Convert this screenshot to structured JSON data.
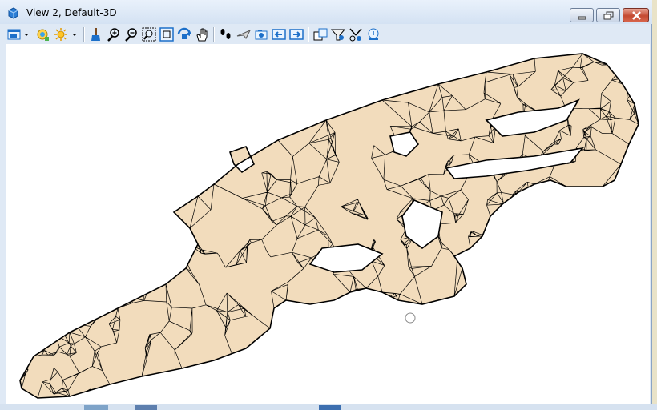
{
  "window": {
    "title": "View 2, Default-3D",
    "controls": {
      "minimize": "minimize",
      "maximize": "restore",
      "close": "close"
    }
  },
  "toolbar": {
    "items": [
      "view-attributes",
      "display-style",
      "lighting",
      "fit-view-brush",
      "zoom-in",
      "zoom-out",
      "window-area",
      "fit-view",
      "rotate-view",
      "pan-view",
      "walk",
      "fly",
      "camera",
      "previous-view",
      "next-view",
      "copy-view",
      "clip-volume",
      "clip-mask",
      "view-info"
    ]
  },
  "viewport": {
    "mesh_fill": "#f2dcbc",
    "mesh_stroke": "#000000",
    "background": "#ffffff",
    "cursor": "circle-cursor"
  },
  "colors": {
    "accent": "#1c6fc9",
    "titlebar": "#dfe9f5",
    "close": "#c44a32"
  }
}
